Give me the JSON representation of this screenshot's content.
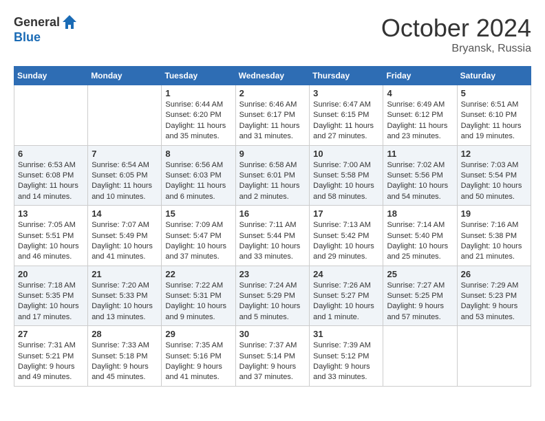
{
  "header": {
    "logo_general": "General",
    "logo_blue": "Blue",
    "month_title": "October 2024",
    "subtitle": "Bryansk, Russia"
  },
  "days_of_week": [
    "Sunday",
    "Monday",
    "Tuesday",
    "Wednesday",
    "Thursday",
    "Friday",
    "Saturday"
  ],
  "weeks": [
    [
      {
        "day": "",
        "info": ""
      },
      {
        "day": "",
        "info": ""
      },
      {
        "day": "1",
        "info": "Sunrise: 6:44 AM\nSunset: 6:20 PM\nDaylight: 11 hours and 35 minutes."
      },
      {
        "day": "2",
        "info": "Sunrise: 6:46 AM\nSunset: 6:17 PM\nDaylight: 11 hours and 31 minutes."
      },
      {
        "day": "3",
        "info": "Sunrise: 6:47 AM\nSunset: 6:15 PM\nDaylight: 11 hours and 27 minutes."
      },
      {
        "day": "4",
        "info": "Sunrise: 6:49 AM\nSunset: 6:12 PM\nDaylight: 11 hours and 23 minutes."
      },
      {
        "day": "5",
        "info": "Sunrise: 6:51 AM\nSunset: 6:10 PM\nDaylight: 11 hours and 19 minutes."
      }
    ],
    [
      {
        "day": "6",
        "info": "Sunrise: 6:53 AM\nSunset: 6:08 PM\nDaylight: 11 hours and 14 minutes."
      },
      {
        "day": "7",
        "info": "Sunrise: 6:54 AM\nSunset: 6:05 PM\nDaylight: 11 hours and 10 minutes."
      },
      {
        "day": "8",
        "info": "Sunrise: 6:56 AM\nSunset: 6:03 PM\nDaylight: 11 hours and 6 minutes."
      },
      {
        "day": "9",
        "info": "Sunrise: 6:58 AM\nSunset: 6:01 PM\nDaylight: 11 hours and 2 minutes."
      },
      {
        "day": "10",
        "info": "Sunrise: 7:00 AM\nSunset: 5:58 PM\nDaylight: 10 hours and 58 minutes."
      },
      {
        "day": "11",
        "info": "Sunrise: 7:02 AM\nSunset: 5:56 PM\nDaylight: 10 hours and 54 minutes."
      },
      {
        "day": "12",
        "info": "Sunrise: 7:03 AM\nSunset: 5:54 PM\nDaylight: 10 hours and 50 minutes."
      }
    ],
    [
      {
        "day": "13",
        "info": "Sunrise: 7:05 AM\nSunset: 5:51 PM\nDaylight: 10 hours and 46 minutes."
      },
      {
        "day": "14",
        "info": "Sunrise: 7:07 AM\nSunset: 5:49 PM\nDaylight: 10 hours and 41 minutes."
      },
      {
        "day": "15",
        "info": "Sunrise: 7:09 AM\nSunset: 5:47 PM\nDaylight: 10 hours and 37 minutes."
      },
      {
        "day": "16",
        "info": "Sunrise: 7:11 AM\nSunset: 5:44 PM\nDaylight: 10 hours and 33 minutes."
      },
      {
        "day": "17",
        "info": "Sunrise: 7:13 AM\nSunset: 5:42 PM\nDaylight: 10 hours and 29 minutes."
      },
      {
        "day": "18",
        "info": "Sunrise: 7:14 AM\nSunset: 5:40 PM\nDaylight: 10 hours and 25 minutes."
      },
      {
        "day": "19",
        "info": "Sunrise: 7:16 AM\nSunset: 5:38 PM\nDaylight: 10 hours and 21 minutes."
      }
    ],
    [
      {
        "day": "20",
        "info": "Sunrise: 7:18 AM\nSunset: 5:35 PM\nDaylight: 10 hours and 17 minutes."
      },
      {
        "day": "21",
        "info": "Sunrise: 7:20 AM\nSunset: 5:33 PM\nDaylight: 10 hours and 13 minutes."
      },
      {
        "day": "22",
        "info": "Sunrise: 7:22 AM\nSunset: 5:31 PM\nDaylight: 10 hours and 9 minutes."
      },
      {
        "day": "23",
        "info": "Sunrise: 7:24 AM\nSunset: 5:29 PM\nDaylight: 10 hours and 5 minutes."
      },
      {
        "day": "24",
        "info": "Sunrise: 7:26 AM\nSunset: 5:27 PM\nDaylight: 10 hours and 1 minute."
      },
      {
        "day": "25",
        "info": "Sunrise: 7:27 AM\nSunset: 5:25 PM\nDaylight: 9 hours and 57 minutes."
      },
      {
        "day": "26",
        "info": "Sunrise: 7:29 AM\nSunset: 5:23 PM\nDaylight: 9 hours and 53 minutes."
      }
    ],
    [
      {
        "day": "27",
        "info": "Sunrise: 7:31 AM\nSunset: 5:21 PM\nDaylight: 9 hours and 49 minutes."
      },
      {
        "day": "28",
        "info": "Sunrise: 7:33 AM\nSunset: 5:18 PM\nDaylight: 9 hours and 45 minutes."
      },
      {
        "day": "29",
        "info": "Sunrise: 7:35 AM\nSunset: 5:16 PM\nDaylight: 9 hours and 41 minutes."
      },
      {
        "day": "30",
        "info": "Sunrise: 7:37 AM\nSunset: 5:14 PM\nDaylight: 9 hours and 37 minutes."
      },
      {
        "day": "31",
        "info": "Sunrise: 7:39 AM\nSunset: 5:12 PM\nDaylight: 9 hours and 33 minutes."
      },
      {
        "day": "",
        "info": ""
      },
      {
        "day": "",
        "info": ""
      }
    ]
  ]
}
